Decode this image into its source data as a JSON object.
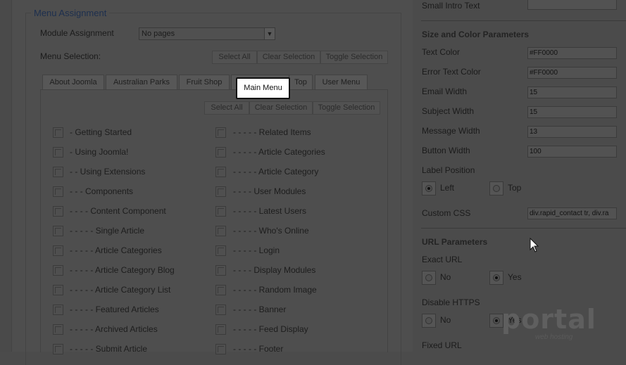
{
  "menu_assignment": {
    "legend": "Menu Assignment",
    "module_assignment_label": "Module Assignment",
    "module_assignment_value": "No pages",
    "menu_selection_label": "Menu Selection:",
    "top_buttons": [
      "Select All",
      "Clear Selection",
      "Toggle Selection"
    ],
    "tabs": [
      "About Joomla",
      "Australian Parks",
      "Fruit Shop",
      "Main Menu",
      "Top",
      "User Menu"
    ],
    "active_tab": "Main Menu",
    "panel_buttons": [
      "Select All",
      "Clear Selection",
      "Toggle Selection"
    ],
    "left_items": [
      "- Getting Started",
      "- Using Joomla!",
      "- - Using Extensions",
      "- - - Components",
      "- - - - Content Component",
      "- - - - - Single Article",
      "- - - - - Article Categories",
      "- - - - - Article Category Blog",
      "- - - - - Article Category List",
      "- - - - - Featured Articles",
      "- - - - - Archived Articles",
      "- - - - - Submit Article"
    ],
    "right_items": [
      "- - - - - Related Items",
      "- - - - - Article Categories",
      "- - - - - Article Category",
      "- - - - User Modules",
      "- - - - - Latest Users",
      "- - - - - Who's Online",
      "- - - - - Login",
      "- - - - Display Modules",
      "- - - - - Random Image",
      "- - - - - Banner",
      "- - - - - Feed Display",
      "- - - - - Footer"
    ]
  },
  "params": {
    "small_intro_text_label": "Small Intro Text",
    "size_color_header": "Size and Color Parameters",
    "fields": [
      {
        "label": "Text Color",
        "value": "#FF0000"
      },
      {
        "label": "Error Text Color",
        "value": "#FF0000"
      },
      {
        "label": "Email Width",
        "value": "15"
      },
      {
        "label": "Subject Width",
        "value": "15"
      },
      {
        "label": "Message Width",
        "value": "13"
      },
      {
        "label": "Button Width",
        "value": "100"
      }
    ],
    "label_position_label": "Label Position",
    "label_position_options": [
      "Left",
      "Top"
    ],
    "label_position_selected": "Left",
    "custom_css_label": "Custom CSS",
    "custom_css_value": "div.rapid_contact tr, div.ra",
    "url_header": "URL Parameters",
    "exact_url_label": "Exact URL",
    "exact_url_options": [
      "No",
      "Yes"
    ],
    "exact_url_selected": "Yes",
    "disable_https_label": "Disable HTTPS",
    "disable_https_options": [
      "No",
      "Yes"
    ],
    "disable_https_selected": "Yes",
    "fixed_url_label": "Fixed URL"
  },
  "watermark": {
    "title": "portal",
    "subtitle": "web hosting"
  }
}
